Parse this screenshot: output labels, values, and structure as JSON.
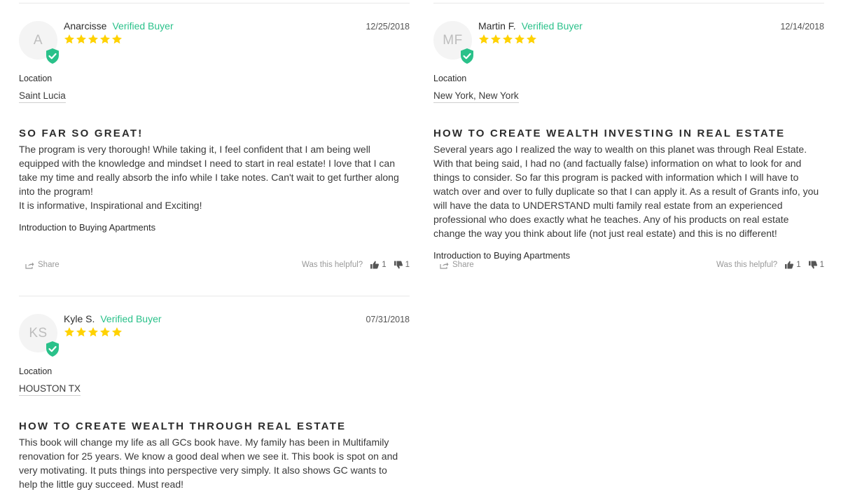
{
  "reviews": [
    {
      "initials": "A",
      "name": "Anarcisse",
      "verified_label": "Verified Buyer",
      "date": "12/25/2018",
      "rating": 5,
      "location_label": "Location",
      "location": "Saint Lucia",
      "title": "SO FAR SO GREAT!",
      "body": [
        "The program is very thorough! While taking it, I feel confident that I am being well equipped with the knowledge and mindset I need to start in real estate! I love that I can take my time and really absorb the info while I take notes. Can't wait to get further along into the program!",
        "It is informative, Inspirational and Exciting!"
      ],
      "product": "Introduction to Buying Apartments",
      "share_label": "Share",
      "helpful_label": "Was this helpful?",
      "upvotes": "1",
      "downvotes": "1"
    },
    {
      "initials": "MF",
      "name": "Martin F.",
      "verified_label": "Verified Buyer",
      "date": "12/14/2018",
      "rating": 5,
      "location_label": "Location",
      "location": "New York, New York",
      "title": "HOW TO CREATE WEALTH INVESTING IN REAL ESTATE",
      "body": [
        "Several years ago I realized the way to wealth on this planet was through Real Estate. With that being said, I had no (and factually false) information on what to look for and things to consider. So far this program is packed with information which I will have to watch over and over to fully duplicate so that I can apply it. As a result of Grants info, you will have the data to UNDERSTAND multi family real estate from an experienced professional who does exactly what he teaches. Any of his products on real estate change the way you think about life (not just real estate) and this is no different!"
      ],
      "product": "Introduction to Buying Apartments",
      "share_label": "Share",
      "helpful_label": "Was this helpful?",
      "upvotes": "1",
      "downvotes": "1"
    },
    {
      "initials": "KS",
      "name": "Kyle S.",
      "verified_label": "Verified Buyer",
      "date": "07/31/2018",
      "rating": 5,
      "location_label": "Location",
      "location": "HOUSTON TX",
      "title": "HOW TO CREATE WEALTH THROUGH REAL ESTATE",
      "body": [
        "This book will change my life as all GCs book have. My family has been in Multifamily renovation for 25 years. We know a good deal when we see it. This book is spot on and very motivating. It puts things into perspective very simply. It also shows GC wants to help the little guy succeed. Must read!"
      ]
    }
  ],
  "colors": {
    "verified": "#2ac18a",
    "star": "#ffd200",
    "badge": "#2ac18a"
  }
}
